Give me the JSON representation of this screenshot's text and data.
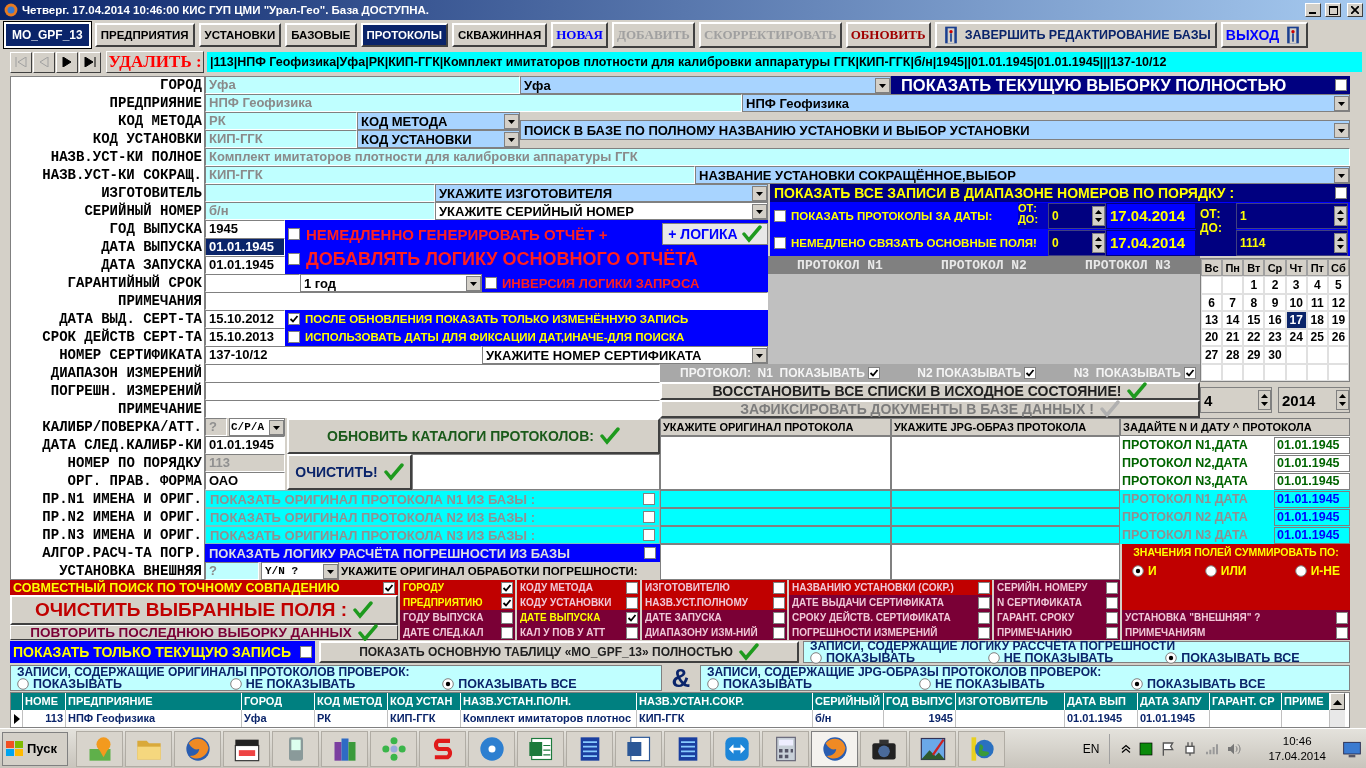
{
  "window": {
    "title": "Четверг. 17.04.2014 10:46:00  КИС ГУП ЦМИ \"Урал-Гео\". База ДОСТУПНА."
  },
  "form_name": "MO_GPF_13",
  "tabs": [
    {
      "label": "ПРЕДПРИЯТИЯ",
      "selected": false
    },
    {
      "label": "УСТАНОВКИ",
      "selected": false
    },
    {
      "label": "БАЗОВЫЕ",
      "selected": false
    },
    {
      "label": "ПРОТОКОЛЫ",
      "selected": true
    },
    {
      "label": "СКВАЖИННАЯ",
      "selected": false
    }
  ],
  "actions": [
    {
      "label": "НОВАЯ",
      "kind": "new",
      "disabled": false
    },
    {
      "label": "ДОБАВИТЬ",
      "kind": "edit",
      "disabled": true
    },
    {
      "label": "СКОРРЕКТИРОВАТЬ",
      "kind": "edit",
      "disabled": true
    },
    {
      "label": "ОБНОВИТЬ",
      "kind": "refresh",
      "disabled": false
    },
    {
      "label": "ЗАВЕРШИТЬ РЕДАКТИРОВАНИЕ БАЗЫ",
      "kind": "finish",
      "disabled": false
    },
    {
      "label": "ВЫХОД",
      "kind": "exit",
      "disabled": false
    }
  ],
  "navigator": {
    "buttons": [
      {
        "kind": "first",
        "disabled": true
      },
      {
        "kind": "prev",
        "disabled": true
      },
      {
        "kind": "next",
        "disabled": false
      },
      {
        "kind": "last",
        "disabled": false
      }
    ],
    "delete_label": "УДАЛИТЬ :",
    "record": "|113|НПФ Геофизика|Уфа|РК|КИП-ГГК|Комплект имитаторов плотности для калибровки аппаратуры ГГК|КИП-ГГК|б/н|1945||01.01.1945|01.01.1945|||137-10/12"
  },
  "labels": [
    "ГОРОД",
    "ПРЕДПРИЯНИЕ",
    "КОД МЕТОДА",
    "КОД УСТАНОВКИ",
    "НАЗВ.УСТ-КИ ПОЛНОЕ",
    "НАЗВ.УСТ-КИ СОКРАЩ.",
    "ИЗГОТОВИТЕЛЬ",
    "СЕРИЙНЫЙ НОМЕР",
    "ГОД ВЫПУСКА",
    "ДАТА ВЫПУСКА",
    "ДАТА ЗАПУСКА",
    "ГАРАНТИЙНЫЙ СРОК",
    "ПРИМЕЧАНИЯ",
    "ДАТА ВЫД. СЕРТ-ТА",
    "СРОК ДЕЙСТВ СЕРТ-ТА",
    "НОМЕР СЕРТИФИКАТА",
    "ДИАПАЗОН ИЗМЕРЕНИЙ",
    "ПОГРЕШН. ИЗМЕРЕНИЙ",
    "ПРИМЕЧАНИЕ",
    "КАЛИБР/ПОВЕРКА/АТТ.",
    "ДАТА СЛЕД.КАЛИБР-КИ",
    "НОМЕР ПО ПОРЯДКУ",
    "ОРГ. ПРАВ. ФОРМА",
    "ПР.N1 ИМЕНА И ОРИГ.",
    "ПР.N2 ИМЕНА И ОРИГ.",
    "ПР.N3 ИМЕНА И ОРИГ.",
    "АЛГОР.РАСЧ-ТА ПОГР.",
    "УСТАНОВКА ВНЕШНЯЯ"
  ],
  "city": {
    "value": "Уфа",
    "combo": "Уфа"
  },
  "show_selection": {
    "label": "ПОКАЗАТЬ ТЕКУЩУЮ ВЫБОРКУ ПОЛНОСТЬЮ",
    "checked": false
  },
  "enterprise": {
    "value": "НПФ Геофизика",
    "combo": "НПФ Геофизика"
  },
  "method_code": {
    "value": "РК",
    "combo": "КОД МЕТОДА"
  },
  "install_code": {
    "value": "КИП-ГГК",
    "combo": "КОД УСТАНОВКИ"
  },
  "search_combo": "ПОИСК В БАЗЕ ПО ПОЛНОМУ НАЗВАНИЮ УСТАНОВКИ И ВЫБОР УСТАНОВКИ",
  "full_name": "Комплект имитаторов плотности для калибровки аппаратуры ГГК",
  "short_name": {
    "value": "КИП-ГГК",
    "combo": "НАЗВАНИЕ УСТАНОВКИ СОКРАЩЁННОЕ,ВЫБОР"
  },
  "maker": {
    "combo": "УКАЖИТЕ ИЗГОТОВИТЕЛЯ"
  },
  "serial": {
    "value": "б/н",
    "combo": "УКАЖИТЕ СЕРИЙНЫЙ НОМЕР"
  },
  "year": "1945",
  "release_date": {
    "value": "01.01.1945",
    "selected": true
  },
  "start_date": "01.01.1945",
  "warranty": {
    "combo": "1 год"
  },
  "cert_issue": "15.10.2012",
  "cert_valid": "15.10.2013",
  "cert_number": {
    "value": "137-10/12",
    "combo": "УКАЖИТЕ НОМЕР СЕРТИФИКАТА"
  },
  "calib": {
    "value": "?",
    "combo": "С/Р/А"
  },
  "next_calib": "01.01.1945",
  "order_number": "113",
  "legal_form": "ОАО",
  "options": [
    {
      "label": "НЕМЕДЛЕННО ГЕНЕРИРОВАТЬ ОТЧЁТ +",
      "checked": false
    },
    {
      "label": "ДОБАВЛЯТЬ ЛОГИКУ ОСНОВНОГО ОТЧЁТА",
      "checked": false
    },
    {
      "label": "ИНВЕРСИЯ ЛОГИКИ ЗАПРОСА",
      "checked": false
    },
    {
      "label": "ПОСЛЕ ОБНОВЛЕНИЯ ПОКАЗАТЬ ТОЛЬКО ИЗМЕНЁННУЮ ЗАПИСЬ",
      "checked": true
    },
    {
      "label": "ИСПОЛЬЗОВАТЬ ДАТЫ ДЛЯ ФИКСАЦИИ ДАТ,ИНАЧЕ-ДЛЯ ПОИСКА",
      "checked": false
    }
  ],
  "logic_button": "+ ЛОГИКА",
  "range": {
    "title": "ПОКАЗАТЬ ВСЕ ЗАПИСИ В ДИАПАЗОНЕ НОМЕРОВ ПО ПОРЯДКУ :",
    "checked": false,
    "dates_label": "ПОКАЗАТЬ ПРОТОКОЛЫ ЗА ДАТЫ:",
    "dates_checked": false,
    "link_label": "НЕМЕДЛЕНО СВЯЗАТЬ ОСНОВНЫЕ ПОЛЯ!",
    "link_checked": false,
    "from": "ОТ:",
    "to": "ДО:",
    "spin_from": "0",
    "spin_to": "0",
    "date_from": "17.04.2014",
    "date_to": "17.04.2014",
    "from2": "ОТ:",
    "to2": "ДО:",
    "num_from": "1",
    "num_to": "1114"
  },
  "protocol_headers": [
    "ПРОТОКОЛ N1",
    "ПРОТОКОЛ N2",
    "ПРОТОКОЛ N3"
  ],
  "protocol_toggles": [
    {
      "label": "ПРОТОКОЛ:  N1  ПОКАЗЫВАТЬ",
      "checked": true
    },
    {
      "label": "N2 ПОКАЗЫВАТЬ",
      "checked": true
    },
    {
      "label": "N3  ПОКАЗЫВАТЬ",
      "checked": true
    }
  ],
  "restore_button": "ВОССТАНОВИТЬ ВСЕ СПИСКИ В ИСХОДНОЕ СОСТОЯНИЕ!",
  "fix_button": {
    "label": "ЗАФИКСИРОВАТЬ ДОКУМЕНТЫ В БАЗЕ ДАННЫХ !",
    "disabled": true
  },
  "calendar": {
    "weekdays": [
      "Вс",
      "Пн",
      "Вт",
      "Ср",
      "Чт",
      "Пт",
      "Сб"
    ],
    "weeks": [
      [
        {
          "day": "1",
          "selected": false
        },
        {
          "day": "2",
          "selected": false
        },
        {
          "day": "3",
          "selected": false
        },
        {
          "day": "4",
          "selected": false
        },
        {
          "day": "5",
          "selected": false
        }
      ],
      [
        {
          "day": "6",
          "selected": false
        },
        {
          "day": "7",
          "selected": false
        },
        {
          "day": "8",
          "selected": false
        },
        {
          "day": "9",
          "selected": false
        },
        {
          "day": "10",
          "selected": false
        },
        {
          "day": "11",
          "selected": false
        },
        {
          "day": "12",
          "selected": false
        }
      ],
      [
        {
          "day": "13",
          "selected": false
        },
        {
          "day": "14",
          "selected": false
        },
        {
          "day": "15",
          "selected": false
        },
        {
          "day": "16",
          "selected": false
        },
        {
          "day": "17",
          "selected": true
        },
        {
          "day": "18",
          "selected": false
        },
        {
          "day": "19",
          "selected": false
        }
      ],
      [
        {
          "day": "20",
          "selected": false
        },
        {
          "day": "21",
          "selected": false
        },
        {
          "day": "22",
          "selected": false
        },
        {
          "day": "23",
          "selected": false
        },
        {
          "day": "24",
          "selected": false
        },
        {
          "day": "25",
          "selected": false
        },
        {
          "day": "26",
          "selected": false
        }
      ],
      [
        {
          "day": "27",
          "selected": false
        },
        {
          "day": "28",
          "selected": false
        },
        {
          "day": "29",
          "selected": false
        },
        {
          "day": "30",
          "selected": false
        }
      ]
    ]
  },
  "month": "4",
  "year_spin": "2014",
  "refresh_catalogs": "ОБНОВИТЬ КАТАЛОГИ ПРОТОКОЛОВ:",
  "clear_button": "ОЧИСТИТЬ!",
  "doc_headers": [
    "УКАЖИТЕ ОРИГИНАЛ ПРОТОКОЛА",
    "УКАЖИТЕ JPG-ОБРАЗ ПРОТОКОЛА",
    "ЗАДАЙТЕ N И ДАТУ ^ ПРОТОКОЛА"
  ],
  "protocol_dates": [
    {
      "label": "ПРОТОКОЛ N1,ДАТА",
      "date": "01.01.1945",
      "kind": "edit"
    },
    {
      "label": "ПРОТОКОЛ N2,ДАТА",
      "date": "01.01.1945",
      "kind": "edit"
    },
    {
      "label": "ПРОТОКОЛ N3,ДАТА",
      "date": "01.01.1945",
      "kind": "edit"
    },
    {
      "label": "ПРОТОКОЛ N1 ДАТА",
      "date": "01.01.1945",
      "kind": "stored"
    },
    {
      "label": "ПРОТОКОЛ N2 ДАТА",
      "date": "01.01.1945",
      "kind": "stored"
    },
    {
      "label": "ПРОТОКОЛ N3 ДАТА",
      "date": "01.01.1945",
      "kind": "stored"
    }
  ],
  "proto_show": [
    {
      "label": "ПОКАЗАТЬ ОРИГИНАЛ ПРОТОКОЛА N1 ИЗ БАЗЫ :",
      "checked": false
    },
    {
      "label": "ПОКАЗАТЬ ОРИГИНАЛ ПРОТОКОЛА N2 ИЗ БАЗЫ :",
      "checked": false
    },
    {
      "label": "ПОКАЗАТЬ ОРИГИНАЛ ПРОТОКОЛА N3 ИЗ БАЗЫ :",
      "checked": false
    }
  ],
  "logic_show": {
    "label": "ПОКАЗАТЬ ЛОГИКУ РАСЧЁТА ПОГРЕШНОСТИ ИЗ БАЗЫ",
    "checked": false
  },
  "external": {
    "value": "?",
    "combo": "Y/N ?",
    "hint": "УКАЖИТЕ ОРИГИНАЛ ОБРАБОТКИ ПОГРЕШНОСТИ:"
  },
  "sum_panel": {
    "title": "ЗНАЧЕНИЯ ПОЛЕЙ СУММИРОВАТЬ ПО:",
    "options": [
      {
        "label": "И",
        "selected": true
      },
      {
        "label": "ИЛИ",
        "selected": false
      },
      {
        "label": "И-НЕ",
        "selected": false
      }
    ]
  },
  "exact_search": {
    "label": "СОВМЕСТНЫЙ ПОИСК ПО ТОЧНОМУ СОВПАДЕНИЮ",
    "checked": true
  },
  "clear_selected": "ОЧИСТИТЬ  ВЫБРАННЫЕ  ПОЛЯ :",
  "repeat_last": "ПОВТОРИТЬ ПОСЛЕДНЮЮ ВЫБОРКУ ДАННЫХ",
  "filters": [
    [
      {
        "label": "ГОРОДУ",
        "checked": true,
        "color": "#c00000"
      },
      {
        "label": "ПРЕДПРИЯТИЮ",
        "checked": true,
        "color": "#c00000"
      },
      {
        "label": "ГОДУ ВЫПУСКА",
        "checked": false,
        "color": "#7a0036"
      },
      {
        "label": "ДАТЕ СЛЕД.КАЛ",
        "checked": false,
        "color": "#7a0036"
      }
    ],
    [
      {
        "label": "КОДУ МЕТОДА",
        "checked": false,
        "color": "#c00000"
      },
      {
        "label": "КОДУ УСТАНОВКИ",
        "checked": false,
        "color": "#c00000"
      },
      {
        "label": "ДАТЕ ВЫПУСКА",
        "checked": true,
        "color": "#7a0036"
      },
      {
        "label": "КАЛ У ПОВ У АТТ",
        "checked": false,
        "color": "#7a0036"
      }
    ],
    [
      {
        "label": "ИЗГОТОВИТЕЛЮ",
        "checked": false,
        "color": "#c00000"
      },
      {
        "label": "НАЗВ.УСТ.ПОЛНОМУ",
        "checked": false,
        "color": "#c00000"
      },
      {
        "label": "ДАТЕ ЗАПУСКА",
        "checked": false,
        "color": "#7a0036"
      },
      {
        "label": "ДИАПАЗОНУ ИЗМ-НИЙ",
        "checked": false,
        "color": "#7a0036"
      }
    ],
    [
      {
        "label": "НАЗВАНИЮ УСТАНОВКИ (СОКР.)",
        "checked": false,
        "color": "#c00000"
      },
      {
        "label": "ДАТЕ ВЫДАЧИ СЕРТИФИКАТА",
        "checked": false,
        "color": "#7a0036"
      },
      {
        "label": "СРОКУ ДЕЙСТВ. СЕРТИФИКАТА",
        "checked": false,
        "color": "#7a0036"
      },
      {
        "label": "ПОГРЕШНОСТИ ИЗМЕРЕНИЙ",
        "checked": false,
        "color": "#7a0036"
      }
    ],
    [
      {
        "label": "СЕРИЙН. НОМЕРУ",
        "checked": false,
        "color": "#7a0036"
      },
      {
        "label": "N СЕРТИФИКАТА",
        "checked": false,
        "color": "#7a0036"
      },
      {
        "label": "ГАРАНТ. СРОКУ",
        "checked": false,
        "color": "#7a0036"
      },
      {
        "label": "ПРИМЕЧАНИЮ",
        "checked": false,
        "color": "#7a0036"
      }
    ],
    [
      {
        "label": "УСТАНОВКА \"ВНЕШНЯЯ\" ?",
        "checked": false,
        "color": "#7a0036"
      },
      {
        "label": "ПРИМЕЧАНИЯМ",
        "checked": false,
        "color": "#7a0036"
      }
    ]
  ],
  "current_only": {
    "label": "ПОКАЗАТЬ ТОЛЬКО ТЕКУЩУЮ ЗАПИСЬ",
    "checked": false
  },
  "show_table": "ПОКАЗАТЬ  ОСНОВНУЮ  ТАБЛИЦУ  «MO_GPF_13»  ПОЛНОСТЬЮ",
  "radio_groups": [
    {
      "title": "ЗАПИСИ, СОДЕРЖАЩИЕ ЛОГИКУ  РАССЧЁТА ПОГРЕШНОСТИ",
      "options": [
        {
          "label": "ПОКАЗЫВАТЬ",
          "selected": false
        },
        {
          "label": "НЕ ПОКАЗЫВАТЬ",
          "selected": false
        },
        {
          "label": "ПОКАЗЫВАТЬ ВСЕ",
          "selected": true
        }
      ]
    },
    {
      "title": "ЗАПИСИ, СОДЕРЖАЩИЕ ОРИГИНАЛЫ ПРОТОКОЛОВ ПРОВЕРОК:",
      "options": [
        {
          "label": "ПОКАЗЫВАТЬ",
          "selected": false
        },
        {
          "label": "НЕ ПОКАЗЫВАТЬ",
          "selected": false
        },
        {
          "label": "ПОКАЗЫВАТЬ ВСЕ",
          "selected": true
        }
      ]
    },
    {
      "title": "ЗАПИСИ, СОДЕРЖАЩИЕ JPG-ОБРАЗЫ ПРОТОКОЛОВ ПРОВЕРОК:",
      "options": [
        {
          "label": "ПОКАЗЫВАТЬ",
          "selected": false
        },
        {
          "label": "НЕ ПОКАЗЫВАТЬ",
          "selected": false
        },
        {
          "label": "ПОКАЗЫВАТЬ ВСЕ",
          "selected": true
        }
      ]
    }
  ],
  "operator": "&",
  "table": {
    "columns": [
      "НОМЕ",
      "ПРЕДПРИЯНИЕ",
      "ГОРОД",
      "КОД МЕТОД",
      "КОД УСТАН",
      "НАЗВ.УСТАН.ПОЛН.",
      "НАЗВ.УСТАН.СОКР.",
      "СЕРИЙНЫЙ",
      "ГОД ВЫПУС",
      "ИЗГОТОВИТЕЛЬ",
      "ДАТА ВЫП",
      "ДАТА ЗАПУ",
      "ГАРАНТ. СР",
      "ПРИМЕ"
    ],
    "rows": [
      [
        "113",
        "НПФ Геофизика",
        "Уфа",
        "РК",
        "КИП-ГГК",
        "Комплект имитаторов плотнос",
        "КИП-ГГК",
        "б/н",
        "1945",
        null,
        "01.01.1945",
        "01.01.1945",
        null,
        null
      ]
    ]
  },
  "taskbar": {
    "start": "Пуск",
    "lang": "EN",
    "time": "10:46",
    "date": "17.04.2014"
  }
}
